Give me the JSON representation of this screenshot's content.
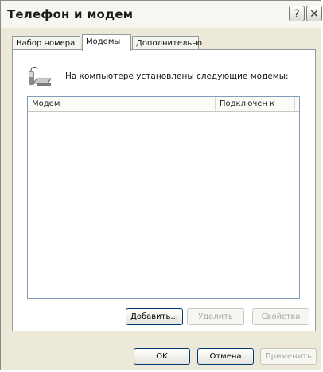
{
  "window": {
    "title": "Телефон и модем"
  },
  "titlebar": {
    "help_glyph": "?",
    "close_glyph": "✕"
  },
  "tabs": [
    {
      "label": "Набор номера",
      "active": false
    },
    {
      "label": "Модемы",
      "active": true
    },
    {
      "label": "Дополнительно",
      "active": false
    }
  ],
  "modems_tab": {
    "icon": "modem-phone-icon",
    "intro": "На компьютере установлены следующие модемы:",
    "columns": [
      "Модем",
      "Подключен к"
    ],
    "rows": [],
    "buttons": {
      "add": "Добавить...",
      "remove": "Удалить",
      "properties": "Свойства"
    }
  },
  "footer": {
    "ok": "OK",
    "cancel": "Отмена",
    "apply": "Применить"
  }
}
